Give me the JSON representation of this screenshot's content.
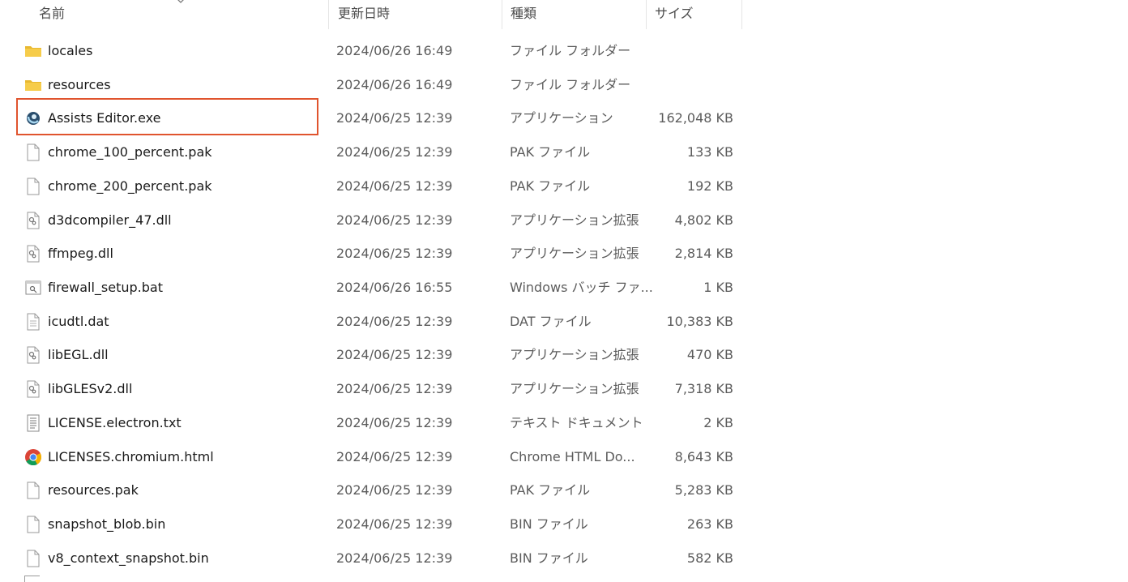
{
  "header": {
    "name": "名前",
    "date": "更新日時",
    "type": "種類",
    "size": "サイズ"
  },
  "files": [
    {
      "name": "locales",
      "date": "2024/06/26 16:49",
      "type": "ファイル フォルダー",
      "size": "",
      "icon": "folder-icon"
    },
    {
      "name": "resources",
      "date": "2024/06/26 16:49",
      "type": "ファイル フォルダー",
      "size": "",
      "icon": "folder-icon"
    },
    {
      "name": "Assists Editor.exe",
      "date": "2024/06/25 12:39",
      "type": "アプリケーション",
      "size": "162,048 KB",
      "icon": "app-icon"
    },
    {
      "name": "chrome_100_percent.pak",
      "date": "2024/06/25 12:39",
      "type": "PAK ファイル",
      "size": "133 KB",
      "icon": "file-icon"
    },
    {
      "name": "chrome_200_percent.pak",
      "date": "2024/06/25 12:39",
      "type": "PAK ファイル",
      "size": "192 KB",
      "icon": "file-icon"
    },
    {
      "name": "d3dcompiler_47.dll",
      "date": "2024/06/25 12:39",
      "type": "アプリケーション拡張",
      "size": "4,802 KB",
      "icon": "dll-icon"
    },
    {
      "name": "ffmpeg.dll",
      "date": "2024/06/25 12:39",
      "type": "アプリケーション拡張",
      "size": "2,814 KB",
      "icon": "dll-icon"
    },
    {
      "name": "firewall_setup.bat",
      "date": "2024/06/26 16:55",
      "type": "Windows バッチ ファ...",
      "size": "1 KB",
      "icon": "batch-icon"
    },
    {
      "name": "icudtl.dat",
      "date": "2024/06/25 12:39",
      "type": "DAT ファイル",
      "size": "10,383 KB",
      "icon": "text-file-icon"
    },
    {
      "name": "libEGL.dll",
      "date": "2024/06/25 12:39",
      "type": "アプリケーション拡張",
      "size": "470 KB",
      "icon": "dll-icon"
    },
    {
      "name": "libGLESv2.dll",
      "date": "2024/06/25 12:39",
      "type": "アプリケーション拡張",
      "size": "7,318 KB",
      "icon": "dll-icon"
    },
    {
      "name": "LICENSE.electron.txt",
      "date": "2024/06/25 12:39",
      "type": "テキスト ドキュメント",
      "size": "2 KB",
      "icon": "text-document-icon"
    },
    {
      "name": "LICENSES.chromium.html",
      "date": "2024/06/25 12:39",
      "type": "Chrome HTML Do...",
      "size": "8,643 KB",
      "icon": "chrome-icon"
    },
    {
      "name": "resources.pak",
      "date": "2024/06/25 12:39",
      "type": "PAK ファイル",
      "size": "5,283 KB",
      "icon": "file-icon"
    },
    {
      "name": "snapshot_blob.bin",
      "date": "2024/06/25 12:39",
      "type": "BIN ファイル",
      "size": "263 KB",
      "icon": "file-icon"
    },
    {
      "name": "v8_context_snapshot.bin",
      "date": "2024/06/25 12:39",
      "type": "BIN ファイル",
      "size": "582 KB",
      "icon": "file-icon"
    }
  ],
  "colors": {
    "highlight": "#e0542e",
    "folder": "#f4c542"
  }
}
